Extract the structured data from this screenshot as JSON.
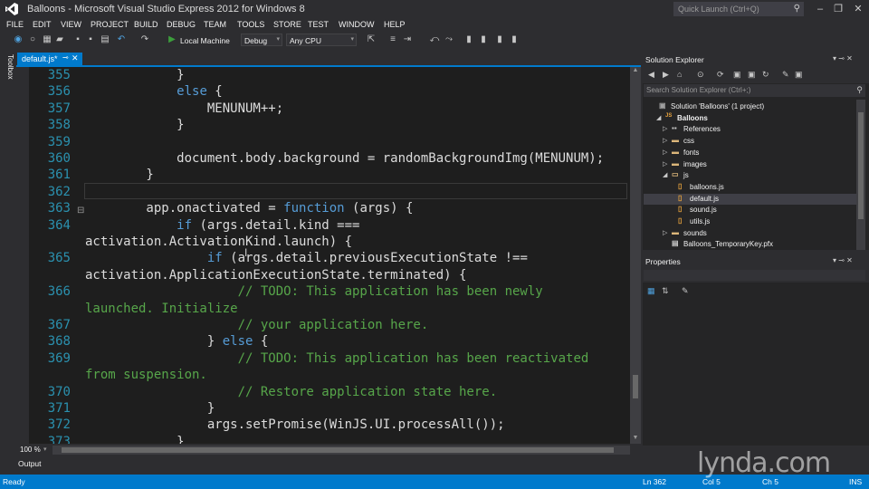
{
  "window": {
    "title": "Balloons - Microsoft Visual Studio Express 2012 for Windows 8",
    "quick_launch_placeholder": "Quick Launch (Ctrl+Q)",
    "minimize": "–",
    "restore": "❐",
    "close": "✕"
  },
  "menu": [
    "FILE",
    "EDIT",
    "VIEW",
    "PROJECT",
    "BUILD",
    "DEBUG",
    "TEAM",
    "TOOLS",
    "STORE",
    "TEST",
    "WINDOW",
    "HELP"
  ],
  "toolbar": {
    "run_target": "Local Machine",
    "configuration": "Debug",
    "platform": "Any CPU"
  },
  "toolbox_label": "Toolbox",
  "editor": {
    "tab_label": "default.js*",
    "zoom": "100 %",
    "lines": [
      {
        "n": "355",
        "segments": [
          {
            "t": "            }",
            "c": "p"
          }
        ]
      },
      {
        "n": "356",
        "segments": [
          {
            "t": "            ",
            "c": "p"
          },
          {
            "t": "else",
            "c": "k"
          },
          {
            "t": " {",
            "c": "p"
          }
        ]
      },
      {
        "n": "357",
        "segments": [
          {
            "t": "                MENUNUM++;",
            "c": "p"
          }
        ]
      },
      {
        "n": "358",
        "segments": [
          {
            "t": "            }",
            "c": "p"
          }
        ]
      },
      {
        "n": "359",
        "segments": [
          {
            "t": "",
            "c": "p"
          }
        ]
      },
      {
        "n": "360",
        "segments": [
          {
            "t": "            document.body.background = randomBackgroundImg(MENUNUM);",
            "c": "p"
          }
        ]
      },
      {
        "n": "361",
        "segments": [
          {
            "t": "        }",
            "c": "p"
          }
        ]
      },
      {
        "n": "362",
        "segments": [
          {
            "t": "",
            "c": "p"
          }
        ]
      },
      {
        "n": "363",
        "segments": [
          {
            "t": "        app.onactivated = ",
            "c": "p"
          },
          {
            "t": "function",
            "c": "k"
          },
          {
            "t": " (args) {",
            "c": "p"
          }
        ]
      },
      {
        "n": "364",
        "segments": [
          {
            "t": "            ",
            "c": "p"
          },
          {
            "t": "if",
            "c": "k"
          },
          {
            "t": " (args.detail.kind ===",
            "c": "p"
          }
        ]
      },
      {
        "n": "",
        "segments": [
          {
            "t": "activation.ActivationKind.launch) {",
            "c": "p"
          }
        ]
      },
      {
        "n": "365",
        "segments": [
          {
            "t": "                ",
            "c": "p"
          },
          {
            "t": "if",
            "c": "k"
          },
          {
            "t": " (args.detail.previousExecutionState !==",
            "c": "p"
          }
        ]
      },
      {
        "n": "",
        "segments": [
          {
            "t": "activation.ApplicationExecutionState.terminated) {",
            "c": "p"
          }
        ]
      },
      {
        "n": "366",
        "segments": [
          {
            "t": "                    // TODO: This application has been newly",
            "c": "c"
          }
        ]
      },
      {
        "n": "",
        "segments": [
          {
            "t": "launched. Initialize",
            "c": "c"
          }
        ]
      },
      {
        "n": "367",
        "segments": [
          {
            "t": "                    // your application here.",
            "c": "c"
          }
        ]
      },
      {
        "n": "368",
        "segments": [
          {
            "t": "                } ",
            "c": "p"
          },
          {
            "t": "else",
            "c": "k"
          },
          {
            "t": " {",
            "c": "p"
          }
        ]
      },
      {
        "n": "369",
        "segments": [
          {
            "t": "                    // TODO: This application has been reactivated",
            "c": "c"
          }
        ]
      },
      {
        "n": "",
        "segments": [
          {
            "t": "from suspension.",
            "c": "c"
          }
        ]
      },
      {
        "n": "370",
        "segments": [
          {
            "t": "                    // Restore application state here.",
            "c": "c"
          }
        ]
      },
      {
        "n": "371",
        "segments": [
          {
            "t": "                }",
            "c": "p"
          }
        ]
      },
      {
        "n": "372",
        "segments": [
          {
            "t": "                args.setPromise(WinJS.UI.processAll());",
            "c": "p"
          }
        ]
      },
      {
        "n": "373",
        "segments": [
          {
            "t": "            }",
            "c": "p"
          }
        ]
      }
    ]
  },
  "solution_explorer": {
    "title": "Solution Explorer",
    "search_placeholder": "Search Solution Explorer (Ctrl+;)",
    "items": [
      {
        "label": "Solution 'Balloons' (1 project)",
        "indent": 0,
        "arrow": "",
        "icon": "solution",
        "selected": false,
        "bold": false
      },
      {
        "label": "Balloons",
        "indent": 1,
        "arrow": "◢",
        "icon": "js-project",
        "selected": false,
        "bold": true
      },
      {
        "label": "References",
        "indent": 2,
        "arrow": "▷",
        "icon": "references",
        "selected": false,
        "bold": false
      },
      {
        "label": "css",
        "indent": 2,
        "arrow": "▷",
        "icon": "folder",
        "selected": false,
        "bold": false
      },
      {
        "label": "fonts",
        "indent": 2,
        "arrow": "▷",
        "icon": "folder",
        "selected": false,
        "bold": false
      },
      {
        "label": "images",
        "indent": 2,
        "arrow": "▷",
        "icon": "folder",
        "selected": false,
        "bold": false
      },
      {
        "label": "js",
        "indent": 2,
        "arrow": "◢",
        "icon": "folder-open",
        "selected": false,
        "bold": false
      },
      {
        "label": "balloons.js",
        "indent": 3,
        "arrow": "",
        "icon": "js-file",
        "selected": false,
        "bold": false
      },
      {
        "label": "default.js",
        "indent": 3,
        "arrow": "",
        "icon": "js-file",
        "selected": true,
        "bold": false
      },
      {
        "label": "sound.js",
        "indent": 3,
        "arrow": "",
        "icon": "js-file",
        "selected": false,
        "bold": false
      },
      {
        "label": "utils.js",
        "indent": 3,
        "arrow": "",
        "icon": "js-file",
        "selected": false,
        "bold": false
      },
      {
        "label": "sounds",
        "indent": 2,
        "arrow": "▷",
        "icon": "folder",
        "selected": false,
        "bold": false
      },
      {
        "label": "Balloons_TemporaryKey.pfx",
        "indent": 2,
        "arrow": "",
        "icon": "key-file",
        "selected": false,
        "bold": false
      }
    ]
  },
  "properties": {
    "title": "Properties"
  },
  "output_label": "Output",
  "status": {
    "ready": "Ready",
    "line": "Ln 362",
    "col": "Col 5",
    "ch": "Ch 5",
    "mode": "INS"
  },
  "watermark": {
    "brand": "lynda",
    "tld": ".com"
  },
  "colors": {
    "accent": "#007acc",
    "keyword": "#569cd6",
    "comment": "#57a64a",
    "line_number": "#2b91af",
    "editor_bg": "#1e1e1e"
  }
}
